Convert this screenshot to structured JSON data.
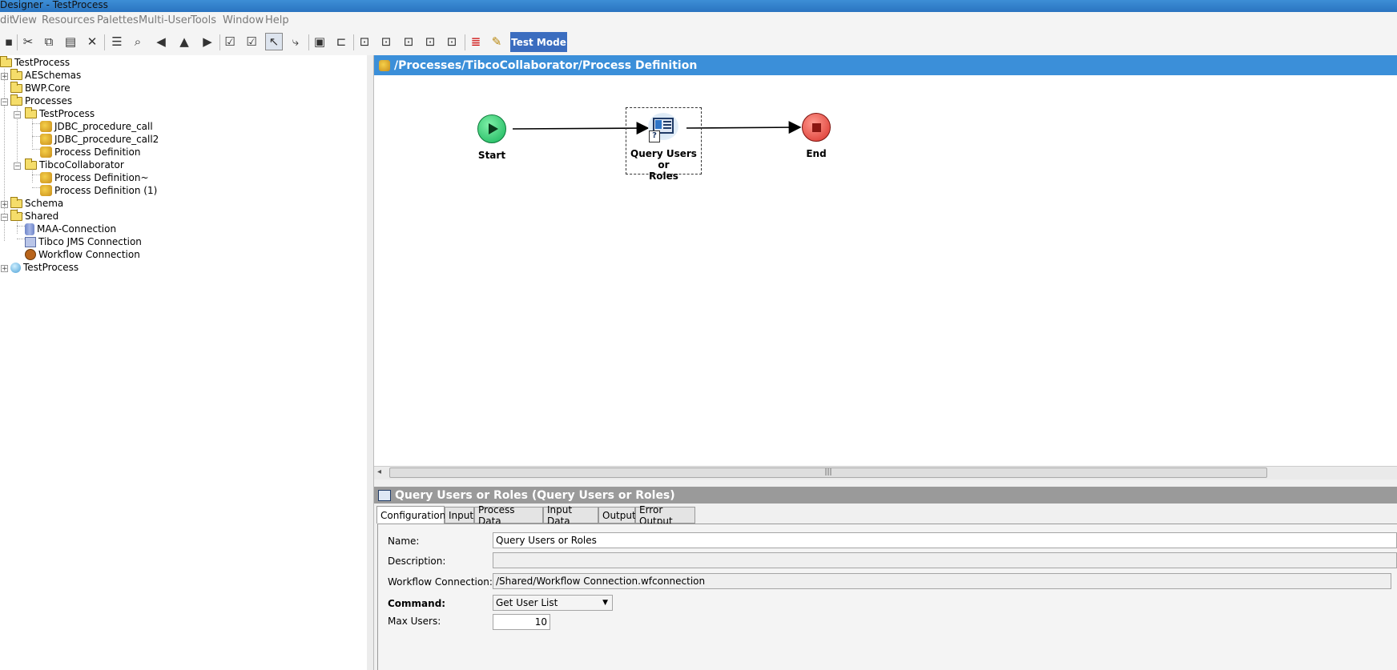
{
  "window": {
    "title": "Designer - TestProcess"
  },
  "menu": [
    "dit",
    "View",
    "Resources",
    "Palettes",
    "Multi-User",
    "Tools",
    "Window",
    "Help"
  ],
  "toolbar": {
    "test_mode_label": "Test Mode"
  },
  "tree": {
    "root": "TestProcess",
    "aeschemas": "AESchemas",
    "bwpcore": "BWP.Core",
    "processes": "Processes",
    "testprocess_folder": "TestProcess",
    "jdbc1": "JDBC_procedure_call",
    "jdbc2": "JDBC_procedure_call2",
    "procdef": "Process Definition",
    "tibco_folder": "TibcoCollaborator",
    "procdef_tilde": "Process Definition~",
    "procdef_1": "Process Definition (1)",
    "schema": "Schema",
    "shared": "Shared",
    "maa": "MAA-Connection",
    "jms": "Tibco JMS Connection",
    "workflow": "Workflow Connection",
    "testprocess_global": "TestProcess"
  },
  "canvas": {
    "path": "/Processes/TibcoCollaborator/Process Definition",
    "start_label": "Start",
    "activity_label_line1": "Query Users or",
    "activity_label_line2": "Roles",
    "end_label": "End",
    "scroll_grip": "|||"
  },
  "details": {
    "title": "Query Users or Roles (Query Users or Roles)",
    "tabs": [
      "Configuration",
      "Input",
      "Process Data",
      "Input Data",
      "Output",
      "Error Output"
    ],
    "fields": {
      "name_label": "Name:",
      "name_value": "Query Users or Roles",
      "description_label": "Description:",
      "description_value": "",
      "workflow_label": "Workflow Connection:",
      "workflow_value": "/Shared/Workflow Connection.wfconnection",
      "command_label": "Command:",
      "command_value": "Get User List",
      "max_users_label": "Max Users:",
      "max_users_value": "10"
    }
  },
  "colors": {
    "canvas_header": "#3b8fd9",
    "test_mode": "#3b6dbf",
    "start": "#2ecc71",
    "end": "#e74c3c"
  }
}
